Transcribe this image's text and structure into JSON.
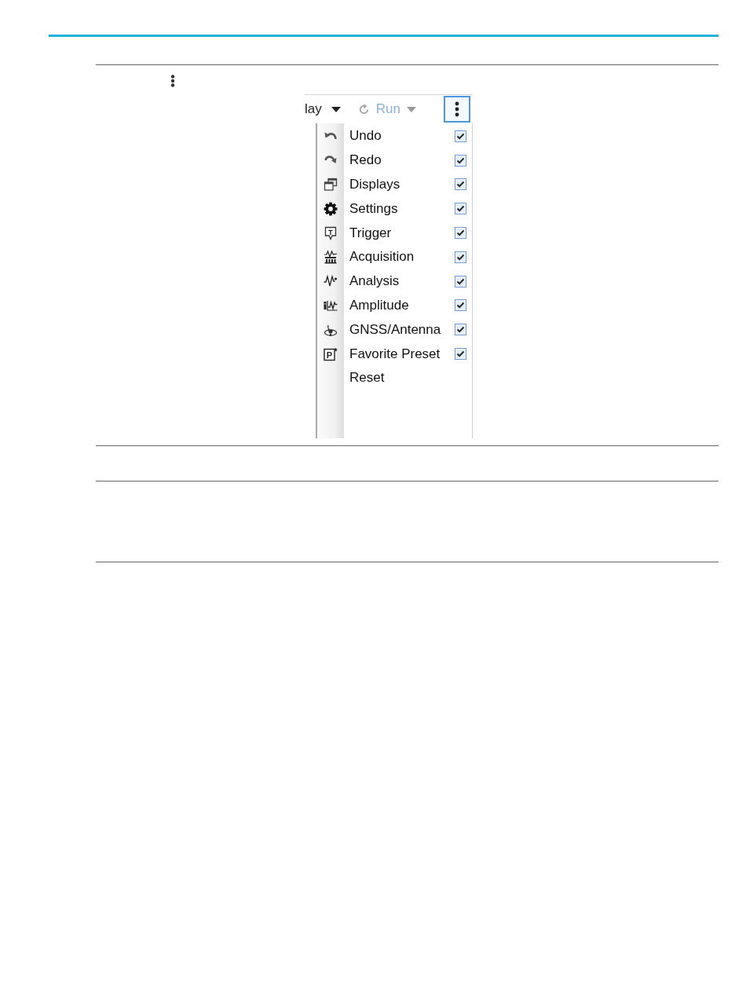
{
  "screenshot": {
    "toolbar": [
      {
        "kind": "dropdown",
        "label": "lay",
        "disabled": false
      },
      {
        "kind": "icon_dropdown",
        "label": "Run",
        "disabled": true
      },
      {
        "kind": "more",
        "open": true
      }
    ],
    "menu": {
      "items": [
        {
          "kind": "toggle",
          "label": "Undo",
          "checked": true
        },
        {
          "kind": "toggle",
          "label": "Redo",
          "checked": true
        },
        {
          "kind": "toggle",
          "label": "Displays",
          "checked": true
        },
        {
          "kind": "toggle",
          "label": "Settings",
          "checked": true
        },
        {
          "kind": "toggle",
          "label": "Trigger",
          "icon_letter": "T",
          "checked": true
        },
        {
          "kind": "toggle",
          "label": "Acquisition",
          "checked": true
        },
        {
          "kind": "toggle",
          "label": "Analysis",
          "checked": true
        },
        {
          "kind": "toggle",
          "label": "Amplitude",
          "checked": true
        },
        {
          "kind": "toggle",
          "label": "GNSS/Antenna",
          "checked": true
        },
        {
          "kind": "toggle",
          "label": "Favorite Preset",
          "icon_letter": "P",
          "checked": true
        },
        {
          "kind": "action",
          "label": "Reset"
        }
      ]
    }
  }
}
